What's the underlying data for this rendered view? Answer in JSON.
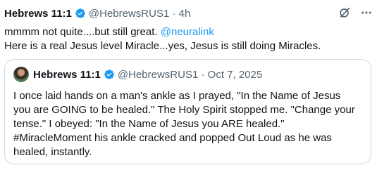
{
  "post": {
    "author_name": "Hebrews 11:1",
    "handle_time": "@HebrewsRUS1 · 4h",
    "line1_prefix": "mmmm not quite....but still great. ",
    "line1_mention": "@neuralink",
    "line2": "Here is a real Jesus level Miracle...yes, Jesus is still doing Miracles."
  },
  "quote": {
    "author_name": "Hebrews 11:1",
    "handle_date": "@HebrewsRUS1 · Oct 7, 2025",
    "lines": [
      "I once laid hands on a man's ankle as I prayed, \"In the Name of Jesus",
      "you are GOING to be healed.\" The Holy Spirit stopped me. \"Change your",
      "tense.\" I obeyed: \"In the Name of Jesus you ARE healed.\"",
      "#MiracleMoment his ankle cracked and popped Out Loud as he was",
      "healed, instantly."
    ]
  },
  "icons": {
    "verified": "verified-badge-icon",
    "grok": "grok-icon",
    "more": "more-options-icon"
  },
  "colors": {
    "verified": "#1d9bf0",
    "link": "#1d9bf0",
    "secondary_text": "#536471",
    "border": "#cfd9de"
  }
}
